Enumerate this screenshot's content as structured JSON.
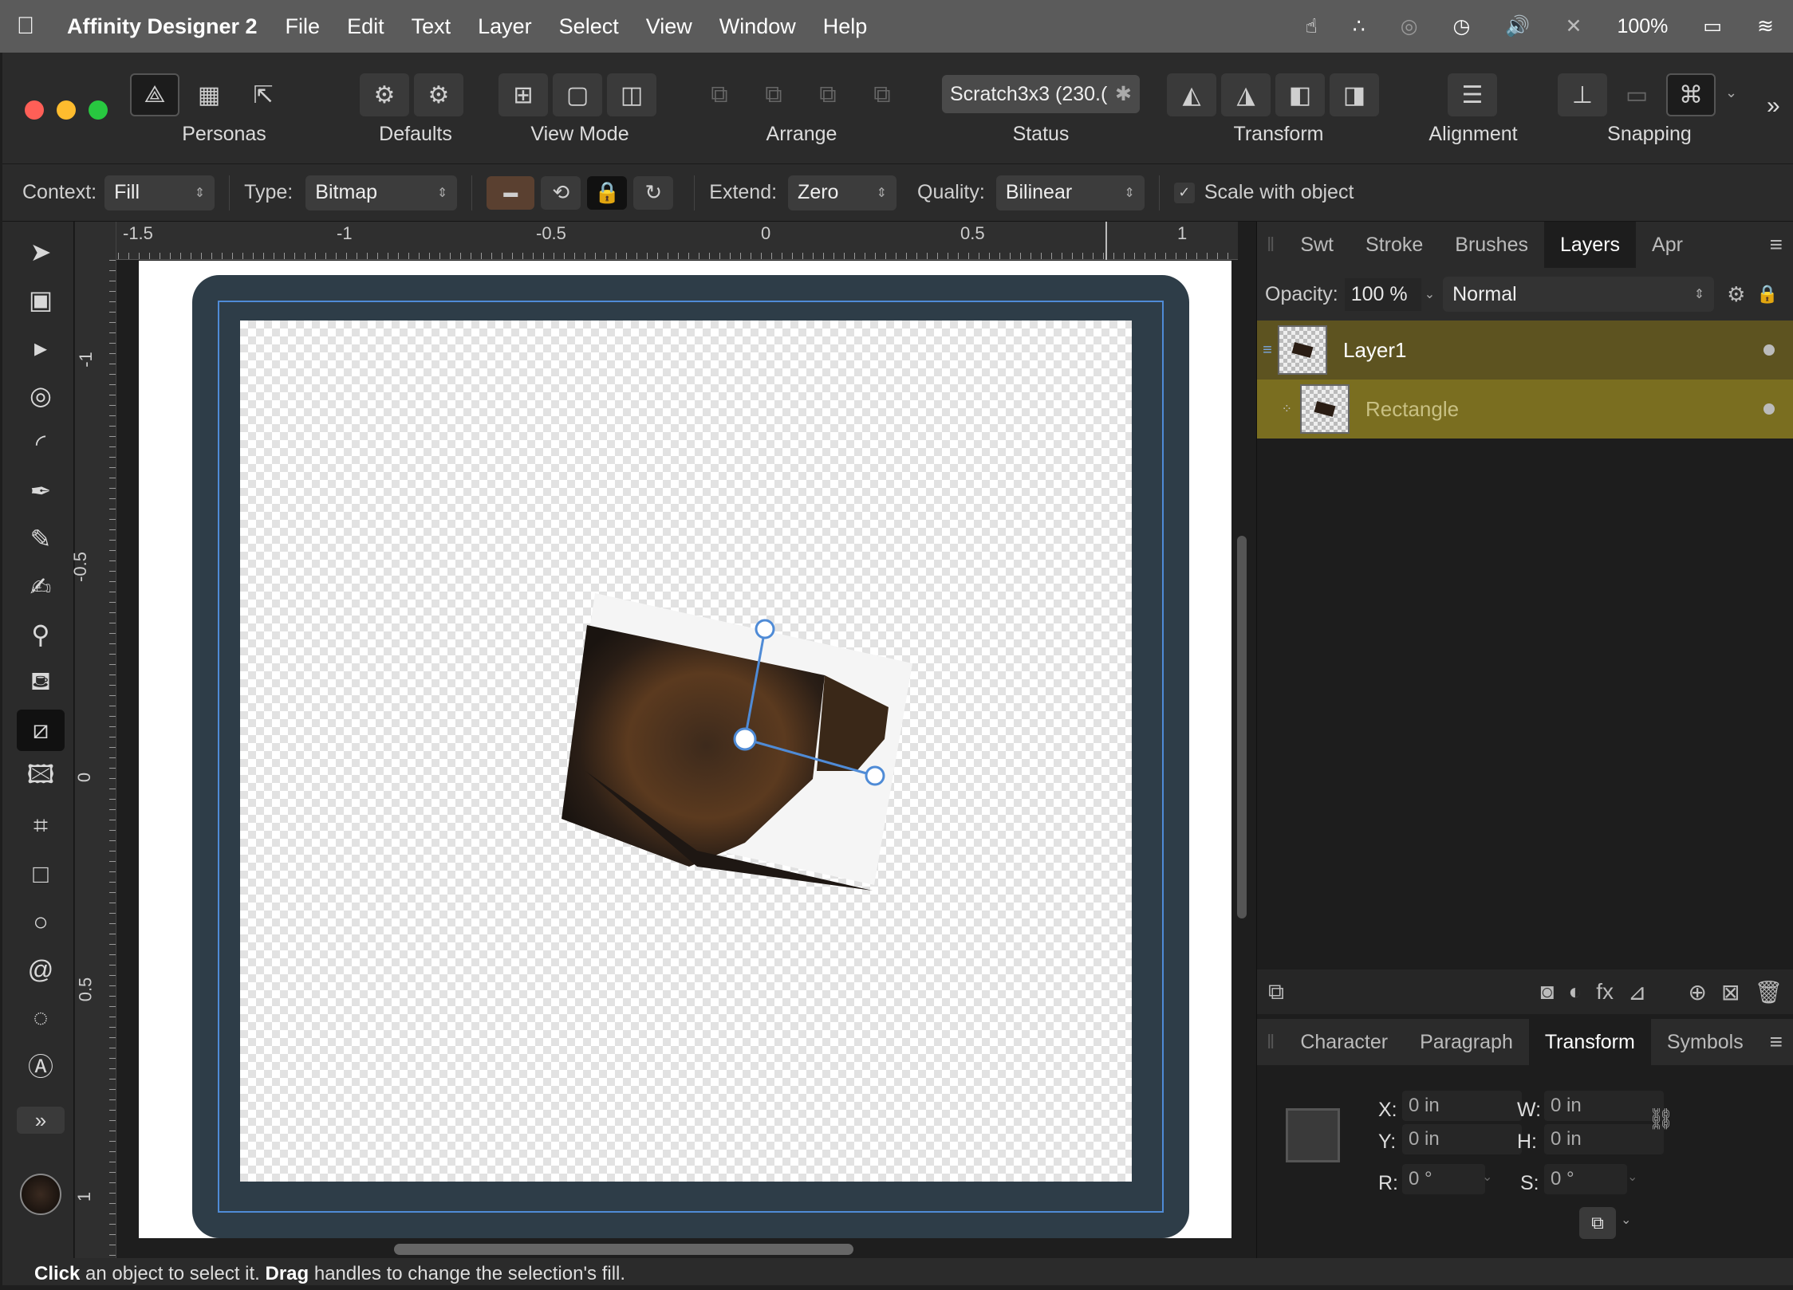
{
  "menubar": {
    "app_name": "Affinity Designer 2",
    "items": [
      "File",
      "Edit",
      "Text",
      "Layer",
      "Select",
      "View",
      "Window",
      "Help"
    ],
    "battery": "100%"
  },
  "toolbar": {
    "personas_label": "Personas",
    "defaults_label": "Defaults",
    "view_mode_label": "View Mode",
    "arrange_label": "Arrange",
    "status_label": "Status",
    "document_name": "Scratch3x3 (230.(",
    "transform_label": "Transform",
    "alignment_label": "Alignment",
    "snapping_label": "Snapping"
  },
  "context": {
    "context_label": "Context:",
    "context_value": "Fill",
    "type_label": "Type:",
    "type_value": "Bitmap",
    "extend_label": "Extend:",
    "extend_value": "Zero",
    "quality_label": "Quality:",
    "quality_value": "Bilinear",
    "scale_label": "Scale with object",
    "scale_checked": true
  },
  "ruler": {
    "unit": "in",
    "h_ticks": [
      "-1.5",
      "-1",
      "-0.5",
      "0",
      "0.5",
      "1"
    ],
    "v_ticks": [
      "-1",
      "-0.5",
      "0",
      "0.5",
      "1"
    ]
  },
  "layers_panel": {
    "tabs": [
      "Swt",
      "Stroke",
      "Brushes",
      "Layers",
      "Apr"
    ],
    "active_tab": "Layers",
    "opacity_label": "Opacity:",
    "opacity_value": "100 %",
    "blend_mode": "Normal",
    "layers": [
      {
        "name": "Layer1"
      },
      {
        "name": "Rectangle"
      }
    ]
  },
  "transform_panel": {
    "tabs": [
      "Character",
      "Paragraph",
      "Transform",
      "Symbols"
    ],
    "active_tab": "Transform",
    "x_label": "X:",
    "x_value": "0 in",
    "y_label": "Y:",
    "y_value": "0 in",
    "w_label": "W:",
    "w_value": "0 in",
    "h_label": "H:",
    "h_value": "0 in",
    "r_label": "R:",
    "r_value": "0 °",
    "s_label": "S:",
    "s_value": "0 °"
  },
  "statusbar": {
    "click": "Click",
    "click_text": " an object to select it. ",
    "drag": "Drag",
    "drag_text": " handles to change the selection's fill."
  },
  "colors": {
    "accent_blue": "#4f8bd6",
    "layer_highlight": "#5d5320",
    "layer_selected": "#7a6e20",
    "frame": "#2e3d48"
  }
}
